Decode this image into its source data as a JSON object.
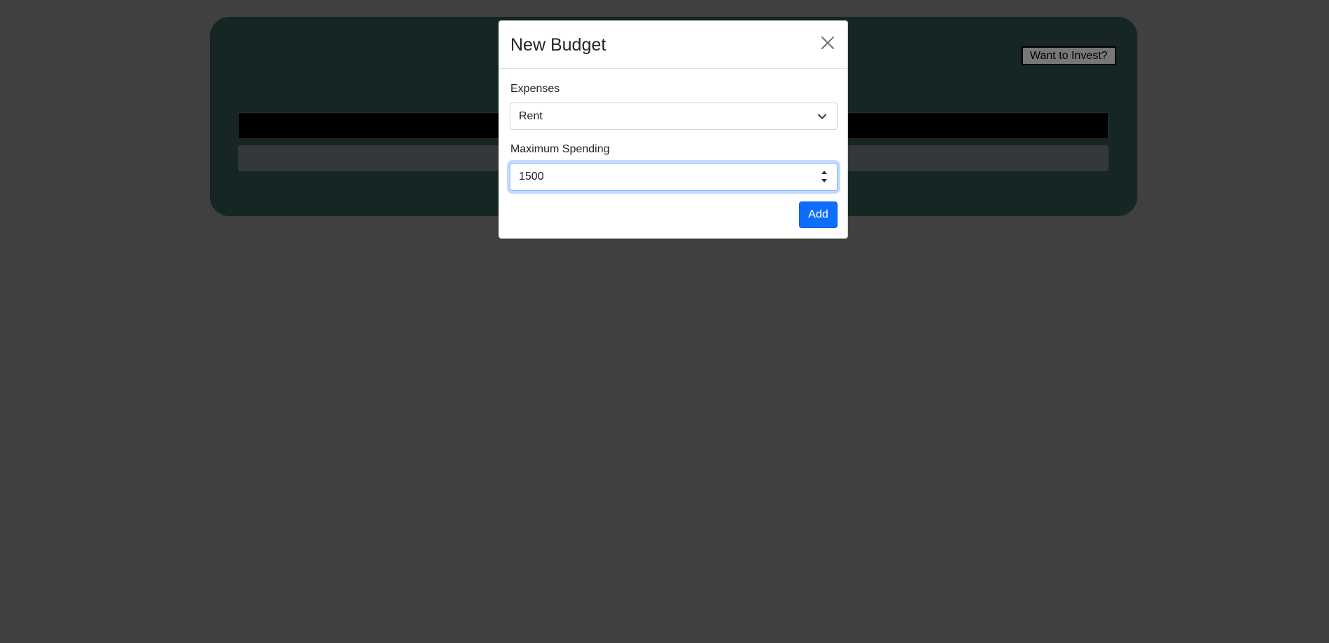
{
  "background_app": {
    "invest_button_label": "Want to Invest?"
  },
  "modal": {
    "title": "New Budget",
    "close_icon": "close-icon",
    "fields": {
      "expenses": {
        "label": "Expenses",
        "selected_value": "Rent"
      },
      "max_spending": {
        "label": "Maximum Spending",
        "value": "1500"
      }
    },
    "add_button_label": "Add"
  },
  "colors": {
    "backdrop": "#808080",
    "panel": "#2b4c48",
    "primary": "#0d6efd",
    "focus_border": "#86b7fe"
  }
}
